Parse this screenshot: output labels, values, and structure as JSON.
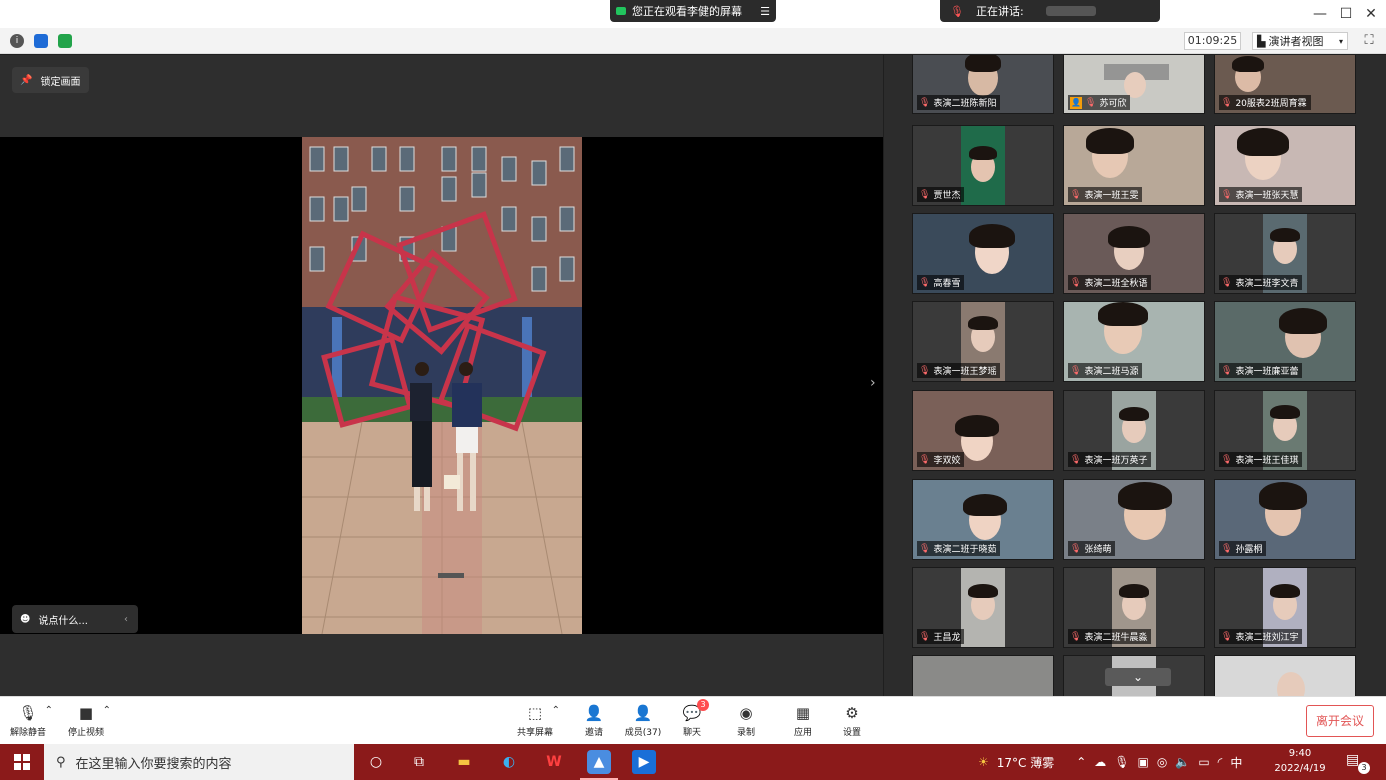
{
  "top": {
    "share_banner": "您正在观看李健的屏幕",
    "speaker_label": "正在讲话:"
  },
  "info_bar": {
    "timer": "01:09:25",
    "view_mode": "演讲者视图"
  },
  "share": {
    "lock_label": "锁定画面",
    "chat_placeholder": "说点什么..."
  },
  "participants": [
    {
      "name": "表演二班陈新阳",
      "muted": true
    },
    {
      "name": "苏可欣",
      "muted": true,
      "no_video_icon": true
    },
    {
      "name": "20服表2班周育霖",
      "muted": true
    },
    {
      "name": "贾世杰",
      "muted": true
    },
    {
      "name": "表演一班王雯",
      "muted": true
    },
    {
      "name": "表演一班张天慧",
      "muted": true
    },
    {
      "name": "高春雪",
      "muted": true
    },
    {
      "name": "表演二班全秋语",
      "muted": true
    },
    {
      "name": "表演二班李文青",
      "muted": true
    },
    {
      "name": "表演一班王梦瑶",
      "muted": true
    },
    {
      "name": "表演二班马源",
      "muted": true
    },
    {
      "name": "表演一班廉亚蕾",
      "muted": true
    },
    {
      "name": "李双姣",
      "muted": true
    },
    {
      "name": "表演一班万英子",
      "muted": true
    },
    {
      "name": "表演一班王佳琪",
      "muted": true
    },
    {
      "name": "表演二班于晓茹",
      "muted": true
    },
    {
      "name": "张绮萌",
      "muted": true
    },
    {
      "name": "孙露桐",
      "muted": true
    },
    {
      "name": "王昌龙",
      "muted": true
    },
    {
      "name": "表演二班牛晨淼",
      "muted": true
    },
    {
      "name": "表演二班刘江宇",
      "muted": true
    }
  ],
  "toolbar": {
    "unmute": "解除静音",
    "stop_video": "停止视频",
    "share_screen": "共享屏幕",
    "invite": "邀请",
    "members": "成员(37)",
    "chat": "聊天",
    "chat_badge": "3",
    "record": "录制",
    "apps": "应用",
    "settings": "设置",
    "leave": "离开会议"
  },
  "taskbar": {
    "search_placeholder": "在这里输入你要搜索的内容",
    "weather": "17°C 薄雾",
    "ime": "中",
    "time": "9:40",
    "date": "2022/4/19",
    "notif_count": "3"
  },
  "colors": {
    "taskbar": "#8b1a1a",
    "leave": "#e25555",
    "sculpture": "#c8344a",
    "share_active": "#22c55e"
  }
}
